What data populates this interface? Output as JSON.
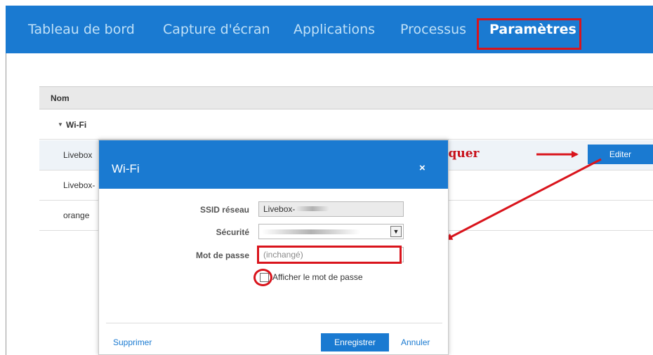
{
  "nav": {
    "tabs": [
      {
        "label": "Tableau de bord"
      },
      {
        "label": "Capture d'écran"
      },
      {
        "label": "Applications"
      },
      {
        "label": "Processus"
      },
      {
        "label": "Paramètres",
        "active": true
      }
    ]
  },
  "table": {
    "header": "Nom",
    "group": "Wi-Fi",
    "rows": [
      {
        "label": "Livebox"
      },
      {
        "label": "Livebox-"
      },
      {
        "label": "orange"
      }
    ],
    "edit_label": "Editer"
  },
  "annotation": {
    "text": "Cliquer"
  },
  "dialog": {
    "title": "Wi-Fi",
    "close": "×",
    "ssid_label": "SSID réseau",
    "ssid_value": "Livebox-",
    "security_label": "Sécurité",
    "password_label": "Mot de passe",
    "password_placeholder": "(inchangé)",
    "show_password_label": "Afficher le mot de passe",
    "delete_label": "Supprimer",
    "save_label": "Enregistrer",
    "cancel_label": "Annuler"
  },
  "colors": {
    "accent": "#1a7ad1",
    "highlight": "#d9141c"
  }
}
